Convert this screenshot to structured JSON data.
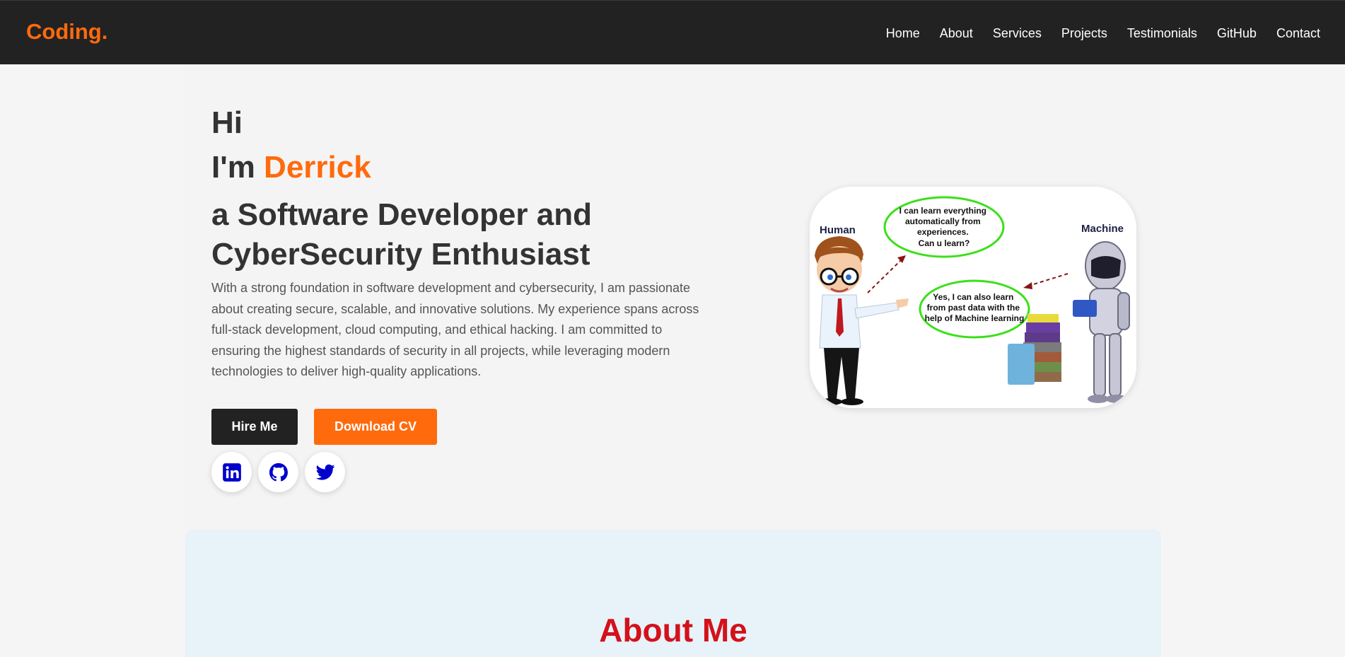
{
  "nav": {
    "logo": "Coding.",
    "links": [
      "Home",
      "About",
      "Services",
      "Projects",
      "Testimonials",
      "GitHub",
      "Contact"
    ]
  },
  "hero": {
    "greeting": "Hi",
    "intro_prefix": "I'm ",
    "name": "Derrick",
    "role": "a Software Developer and CyberSecurity Enthusiast",
    "description": "With a strong foundation in software development and cybersecurity, I am passionate about creating secure, scalable, and innovative solutions. My experience spans across full-stack development, cloud computing, and ethical hacking. I am committed to ensuring the highest standards of security in all projects, while leveraging modern technologies to deliver high-quality applications.",
    "hire_label": "Hire Me",
    "cv_label": "Download CV",
    "socials": [
      "linkedin-icon",
      "github-icon",
      "twitter-icon"
    ]
  },
  "illustration": {
    "human_label": "Human",
    "machine_label": "Machine",
    "bubble_machine": [
      "I can learn everything",
      "automatically  from",
      "experiences.",
      "Can u learn?"
    ],
    "bubble_human": [
      "Yes, I can also learn",
      "from past data with the",
      "help of Machine learning"
    ]
  },
  "about": {
    "title": "About Me"
  },
  "colors": {
    "accent": "#ff6a0d",
    "nav_bg": "#222222",
    "about_title": "#d3111b",
    "social_icon": "#0000cc"
  }
}
